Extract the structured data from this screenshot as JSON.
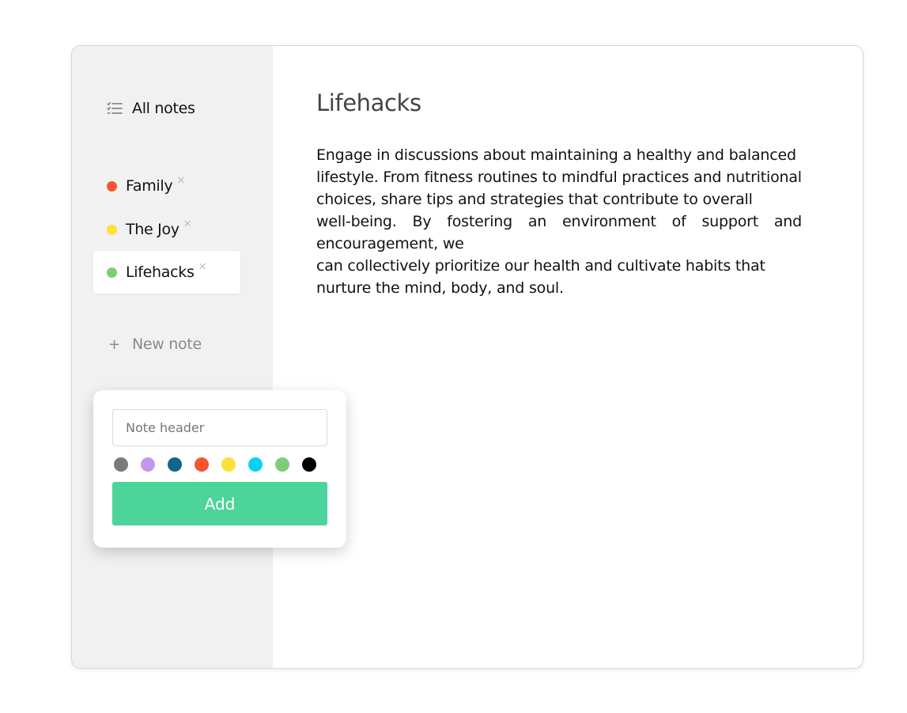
{
  "sidebar": {
    "all_notes_label": "All notes",
    "all_notes_icon": "list-icon",
    "notes": [
      {
        "label": "Family",
        "color": "#f4552e",
        "active": false
      },
      {
        "label": "The Joy",
        "color": "#fde03a",
        "active": false
      },
      {
        "label": "Lifehacks",
        "color": "#7ecb7a",
        "active": true
      }
    ],
    "remove_glyph": "✕",
    "new_note_plus": "+",
    "new_note_label": "New note"
  },
  "note": {
    "title": "Lifehacks",
    "body": "Engage in discussions about maintaining a healthy and balanced\nlifestyle. From fitness routines to mindful practices and nutritional\nchoices, share tips and strategies that contribute to overall\nwell-being. By fostering an environment of support and encouragement, we\n can collectively prioritize our health and cultivate habits that\nnurture the mind, body, and soul."
  },
  "new_note_popup": {
    "header_placeholder": "Note header",
    "colors": [
      "#7b7b7b",
      "#c497ec",
      "#0f6689",
      "#f4552e",
      "#fde03a",
      "#07d0f6",
      "#7ecb7a",
      "#000000"
    ],
    "add_label": "Add",
    "add_color": "#4cd49a"
  }
}
